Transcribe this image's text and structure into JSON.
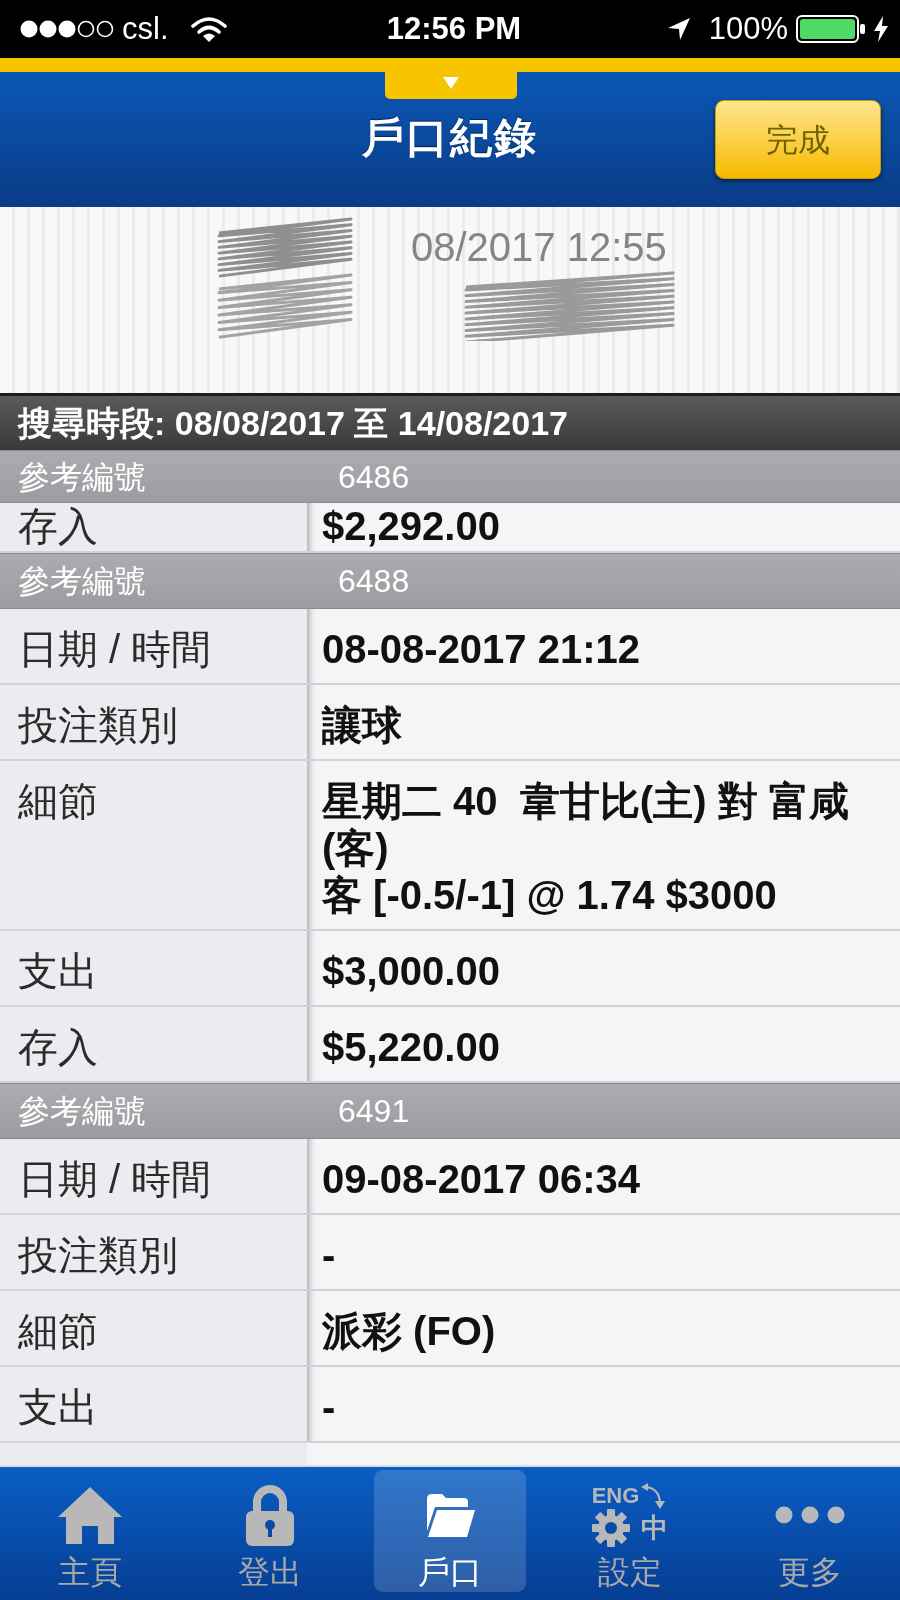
{
  "status_bar": {
    "carrier": "csl.",
    "time": "12:56 PM",
    "battery": "100%"
  },
  "header": {
    "title": "戶口紀錄",
    "done_button": "完成"
  },
  "receipt": {
    "visible_text": "08/2017 12:55"
  },
  "search_period": "搜尋時段: 08/08/2017 至 14/08/2017",
  "records": [
    {
      "ref_label": "參考編號",
      "ref": "6486",
      "fields": [
        {
          "label": "存入",
          "value": "$2,292.00",
          "partly_scrolled": true
        }
      ]
    },
    {
      "ref_label": "參考編號",
      "ref": "6488",
      "fields": [
        {
          "label": "日期 / 時間",
          "value": "08-08-2017 21:12",
          "partly_scrolled": false
        },
        {
          "label": "投注類別",
          "value": "讓球",
          "partly_scrolled": false
        },
        {
          "label": "細節",
          "value": "星期二 40  韋甘比(主) 對 富咸\n(客)\n客 [-0.5/-1] @ 1.74 $3000",
          "partly_scrolled": false
        },
        {
          "label": "支出",
          "value": "$3,000.00",
          "partly_scrolled": false
        },
        {
          "label": "存入",
          "value": "$5,220.00",
          "partly_scrolled": false
        }
      ]
    },
    {
      "ref_label": "參考編號",
      "ref": "6491",
      "fields": [
        {
          "label": "日期 / 時間",
          "value": "09-08-2017 06:34",
          "partly_scrolled": false
        },
        {
          "label": "投注類別",
          "value": "-",
          "partly_scrolled": false
        },
        {
          "label": "細節",
          "value": "派彩 (FO)",
          "partly_scrolled": false
        },
        {
          "label": "支出",
          "value": "-",
          "partly_scrolled": false
        }
      ]
    }
  ],
  "tab_bar": [
    {
      "kind": "home",
      "label": "主頁",
      "selected": false
    },
    {
      "kind": "lock",
      "label": "登出",
      "selected": false
    },
    {
      "kind": "folder",
      "label": "戶口",
      "selected": true
    },
    {
      "kind": "settings",
      "label": "設定",
      "selected": false,
      "icon_texts": [
        "ENG",
        "中"
      ]
    },
    {
      "kind": "more",
      "label": "更多",
      "selected": false
    }
  ]
}
